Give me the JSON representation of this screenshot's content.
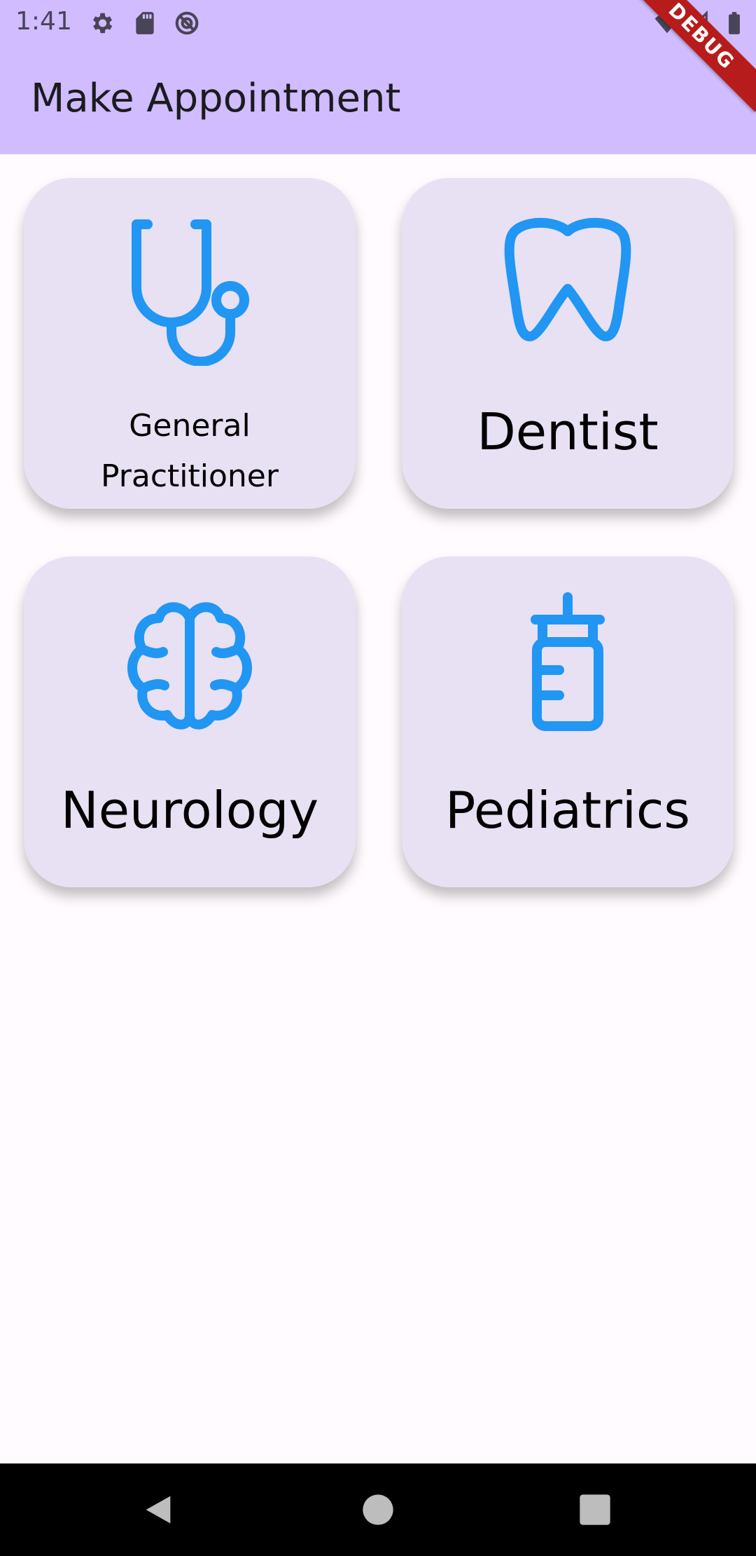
{
  "status_bar": {
    "time": "1:41",
    "icons": [
      "settings-icon",
      "sd-card-icon",
      "no-disturb-icon",
      "wifi-icon",
      "signal-icon",
      "battery-icon"
    ]
  },
  "app_bar": {
    "title": "Make Appointment",
    "debug_banner": "DEBUG",
    "background_color": "#d0bcff"
  },
  "categories": [
    {
      "label": "General Practitioner",
      "icon": "stethoscope-icon"
    },
    {
      "label": "Dentist",
      "icon": "tooth-icon"
    },
    {
      "label": "Neurology",
      "icon": "brain-icon"
    },
    {
      "label": "Pediatrics",
      "icon": "baby-bottle-icon"
    }
  ],
  "colors": {
    "icon_blue": "#2196f3",
    "card_bg": "#e8e0f3",
    "page_bg": "#fffbfe"
  },
  "nav_bar": {
    "buttons": [
      "back-icon",
      "home-icon",
      "recents-icon"
    ]
  }
}
